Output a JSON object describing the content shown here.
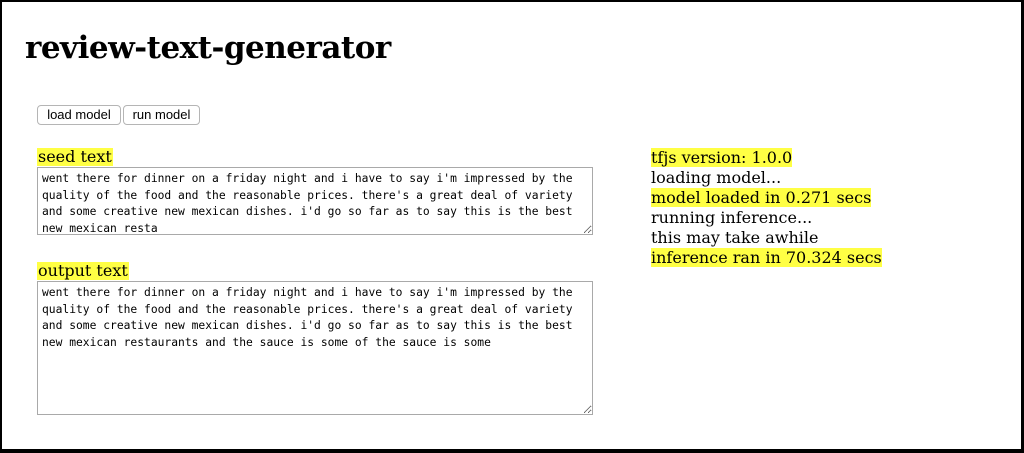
{
  "page": {
    "title": "review-text-generator"
  },
  "buttons": {
    "load_label": "load model",
    "run_label": "run model"
  },
  "seed": {
    "label": "seed text",
    "value": "went there for dinner on a friday night and i have to say i'm impressed by the quality of the food and the reasonable prices. there's a great deal of variety and some creative new mexican dishes. i'd go so far as to say this is the best new mexican resta"
  },
  "output": {
    "label": "output text",
    "value": "went there for dinner on a friday night and i have to say i'm impressed by the quality of the food and the reasonable prices. there's a great deal of variety and some creative new mexican dishes. i'd go so far as to say this is the best new mexican restaurants and the sauce is some of the sauce is some"
  },
  "log": {
    "lines": [
      {
        "text": "tfjs version: 1.0.0",
        "highlight": true
      },
      {
        "text": "loading model...",
        "highlight": false
      },
      {
        "text": "model loaded in 0.271 secs",
        "highlight": true
      },
      {
        "text": "running inference...",
        "highlight": false
      },
      {
        "text": "this may take awhile",
        "highlight": false
      },
      {
        "text": "inference ran in 70.324 secs",
        "highlight": true
      }
    ]
  },
  "colors": {
    "highlight": "#ffff44",
    "frame_border": "#000000"
  }
}
